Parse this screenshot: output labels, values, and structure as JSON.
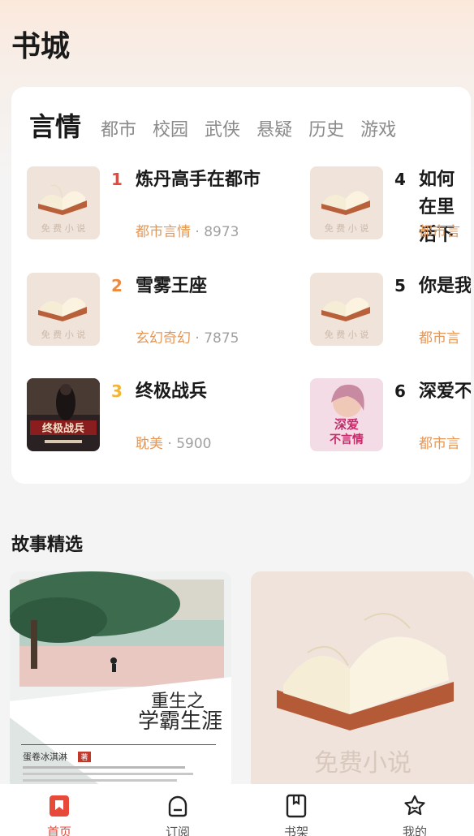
{
  "header": {
    "title": "书城"
  },
  "ranking": {
    "tabs": [
      "言情",
      "都市",
      "校园",
      "武侠",
      "悬疑",
      "历史",
      "游戏"
    ],
    "active_tab": 0,
    "books": [
      {
        "rank": "1",
        "title": "炼丹高手在都市",
        "category": "都市言情",
        "separator": "·",
        "count": "8973",
        "cover": "free-novel-cover",
        "rank_color": "#e8483a"
      },
      {
        "rank": "2",
        "title": "雪雾王座",
        "category": "玄幻奇幻",
        "separator": "·",
        "count": "7875",
        "cover": "free-novel-cover",
        "rank_color": "#ef8a3c"
      },
      {
        "rank": "3",
        "title": "终极战兵",
        "category": "耽美",
        "separator": "·",
        "count": "5900",
        "cover": "soldier-cover",
        "rank_color": "#f2b534"
      },
      {
        "rank": "4",
        "title": "如何在里活下",
        "category": "都市言",
        "separator": "",
        "count": "",
        "cover": "free-novel-cover",
        "rank_color": "#1a1a1a"
      },
      {
        "rank": "5",
        "title": "你是我",
        "category": "都市言",
        "separator": "",
        "count": "",
        "cover": "free-novel-cover",
        "rank_color": "#1a1a1a"
      },
      {
        "rank": "6",
        "title": "深爱不",
        "category": "都市言",
        "separator": "",
        "count": "",
        "cover": "romance-cover",
        "rank_color": "#1a1a1a"
      }
    ]
  },
  "stories": {
    "title": "故事精选",
    "cards": [
      {
        "cover": "school-cover",
        "cover_title_line1": "重生之",
        "cover_title_line2": "学霸生涯",
        "cover_author": "蛋卷冰淇淋",
        "cover_author_tag": "著"
      },
      {
        "cover": "free-novel-cover",
        "cover_text": "免费小说"
      }
    ]
  },
  "cover_texts": {
    "free_novel": "免 费 小 说",
    "soldier_line1": "终极战兵",
    "romance_line1": "深爱",
    "romance_line2": "不言情"
  },
  "bottom_nav": [
    {
      "label": "首页",
      "icon": "bookmark-icon",
      "active": true
    },
    {
      "label": "订阅",
      "icon": "subscribe-icon",
      "active": false
    },
    {
      "label": "书架",
      "icon": "bookshelf-icon",
      "active": false
    },
    {
      "label": "我的",
      "icon": "profile-star-icon",
      "active": false
    }
  ],
  "colors": {
    "accent": "#e84a3a",
    "category": "#e49858",
    "rank1": "#e8483a",
    "rank2": "#ef8a3c",
    "rank3": "#f2b534"
  }
}
